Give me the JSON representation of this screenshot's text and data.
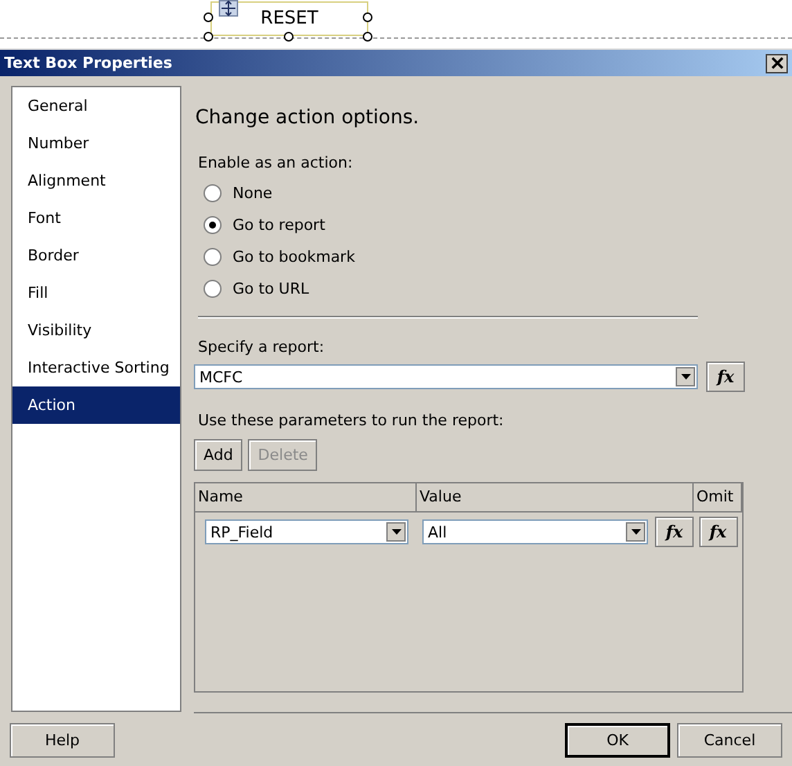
{
  "designer": {
    "textbox": "RESET"
  },
  "window": {
    "title": "Text Box Properties"
  },
  "sidebar": {
    "items": [
      {
        "label": "General",
        "selected": false
      },
      {
        "label": "Number",
        "selected": false
      },
      {
        "label": "Alignment",
        "selected": false
      },
      {
        "label": "Font",
        "selected": false
      },
      {
        "label": "Border",
        "selected": false
      },
      {
        "label": "Fill",
        "selected": false
      },
      {
        "label": "Visibility",
        "selected": false
      },
      {
        "label": "Interactive Sorting",
        "selected": false
      },
      {
        "label": "Action",
        "selected": true
      }
    ]
  },
  "heading": "Change action options.",
  "action_group": {
    "label": "Enable as an action:",
    "options": [
      {
        "label": "None",
        "selected": false
      },
      {
        "label": "Go to report",
        "selected": true
      },
      {
        "label": "Go to bookmark",
        "selected": false
      },
      {
        "label": "Go to URL",
        "selected": false
      }
    ]
  },
  "report": {
    "label": "Specify a report:",
    "value": "MCFC",
    "fx": "fx"
  },
  "parameters": {
    "label": "Use these parameters to run the report:",
    "buttons": [
      {
        "label": "Add",
        "disabled": false
      },
      {
        "label": "Delete",
        "disabled": true
      }
    ],
    "columns": [
      "Name",
      "Value",
      "Omit"
    ],
    "rows": [
      {
        "name": "RP_Field",
        "value": "All",
        "value_fx": "fx",
        "omit_fx": "fx"
      }
    ]
  },
  "buttons": {
    "help": "Help",
    "ok": "OK",
    "cancel": "Cancel"
  }
}
